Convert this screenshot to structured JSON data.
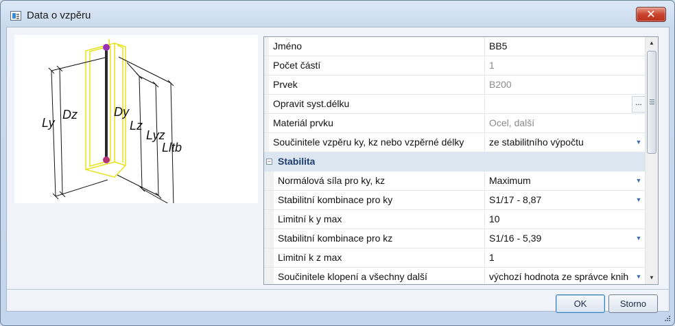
{
  "window": {
    "title": "Data o vzpěru"
  },
  "diagram_labels": {
    "ly": "Ly",
    "dz": "Dz",
    "dy": "Dy",
    "lz": "Lz",
    "lyz": "Lyz",
    "lltb": "Lltb"
  },
  "properties": {
    "rows": [
      {
        "name": "Jméno",
        "value": "BB5"
      },
      {
        "name": "Počet částí",
        "value": "1"
      },
      {
        "name": "Prvek",
        "value": "B200"
      },
      {
        "name": "Opravit syst.délku",
        "value": "",
        "button": "..."
      },
      {
        "name": "Materiál prvku",
        "value": "Ocel, další"
      },
      {
        "name": "Součinitele vzpěru ky, kz nebo vzpěrné délky",
        "value": "ze stabilitního výpočtu"
      }
    ],
    "category": {
      "label": "Stabilita",
      "toggle": "−"
    },
    "stability_rows": [
      {
        "name": "Normálová síla pro ky, kz",
        "value": "Maximum"
      },
      {
        "name": "Stabilitní kombinace pro ky",
        "value": "S1/17 - 8,87"
      },
      {
        "name": "Limitní k y max",
        "value": "10"
      },
      {
        "name": "Stabilitní kombinace pro kz",
        "value": "S1/16 - 5,39"
      },
      {
        "name": "Limitní k z max",
        "value": "1"
      },
      {
        "name": "Součinitele klopení a všechny další",
        "value": "výchozí hodnota ze správce knih"
      }
    ]
  },
  "buttons": {
    "ok": "OK",
    "cancel": "Storno"
  }
}
